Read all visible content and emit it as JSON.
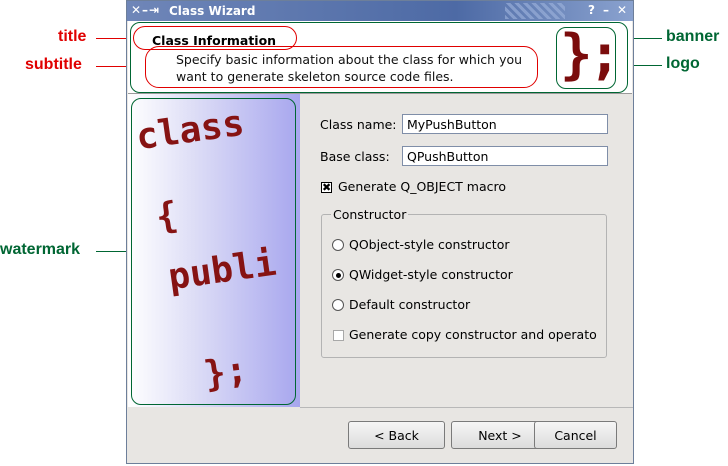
{
  "window": {
    "title": "Class Wizard",
    "left_controls": "✕–⇥",
    "right_controls": [
      "?",
      "–",
      "✕"
    ]
  },
  "header": {
    "title": "Class Information",
    "subtitle_line1": "Specify basic information about the class for which you",
    "subtitle_line2": "want to generate skeleton source code files.",
    "logo_text": "};"
  },
  "watermark": {
    "lines": [
      "class",
      "{",
      "publi",
      "};"
    ]
  },
  "form": {
    "class_name_label": "Class name:",
    "class_name_value": "MyPushButton",
    "base_class_label": "Base class:",
    "base_class_value": "QPushButton",
    "generate_qobject_label": "Generate Q_OBJECT macro",
    "generate_qobject_checked": "✖",
    "constructor_group_title": "Constructor",
    "radio_qobject": "QObject-style constructor",
    "radio_qwidget": "QWidget-style constructor",
    "radio_default": "Default constructor",
    "copy_ctor_label": "Generate copy constructor and operato"
  },
  "buttons": {
    "back": "< Back",
    "next": "Next >",
    "cancel": "Cancel"
  },
  "annotations": {
    "title": "title",
    "subtitle": "subtitle",
    "watermark": "watermark",
    "banner": "banner",
    "logo": "logo"
  },
  "colors": {
    "annotation_red": "#e00000",
    "annotation_green": "#006633",
    "watermark_text": "#861313",
    "titlebar": "#4d6aa5"
  }
}
